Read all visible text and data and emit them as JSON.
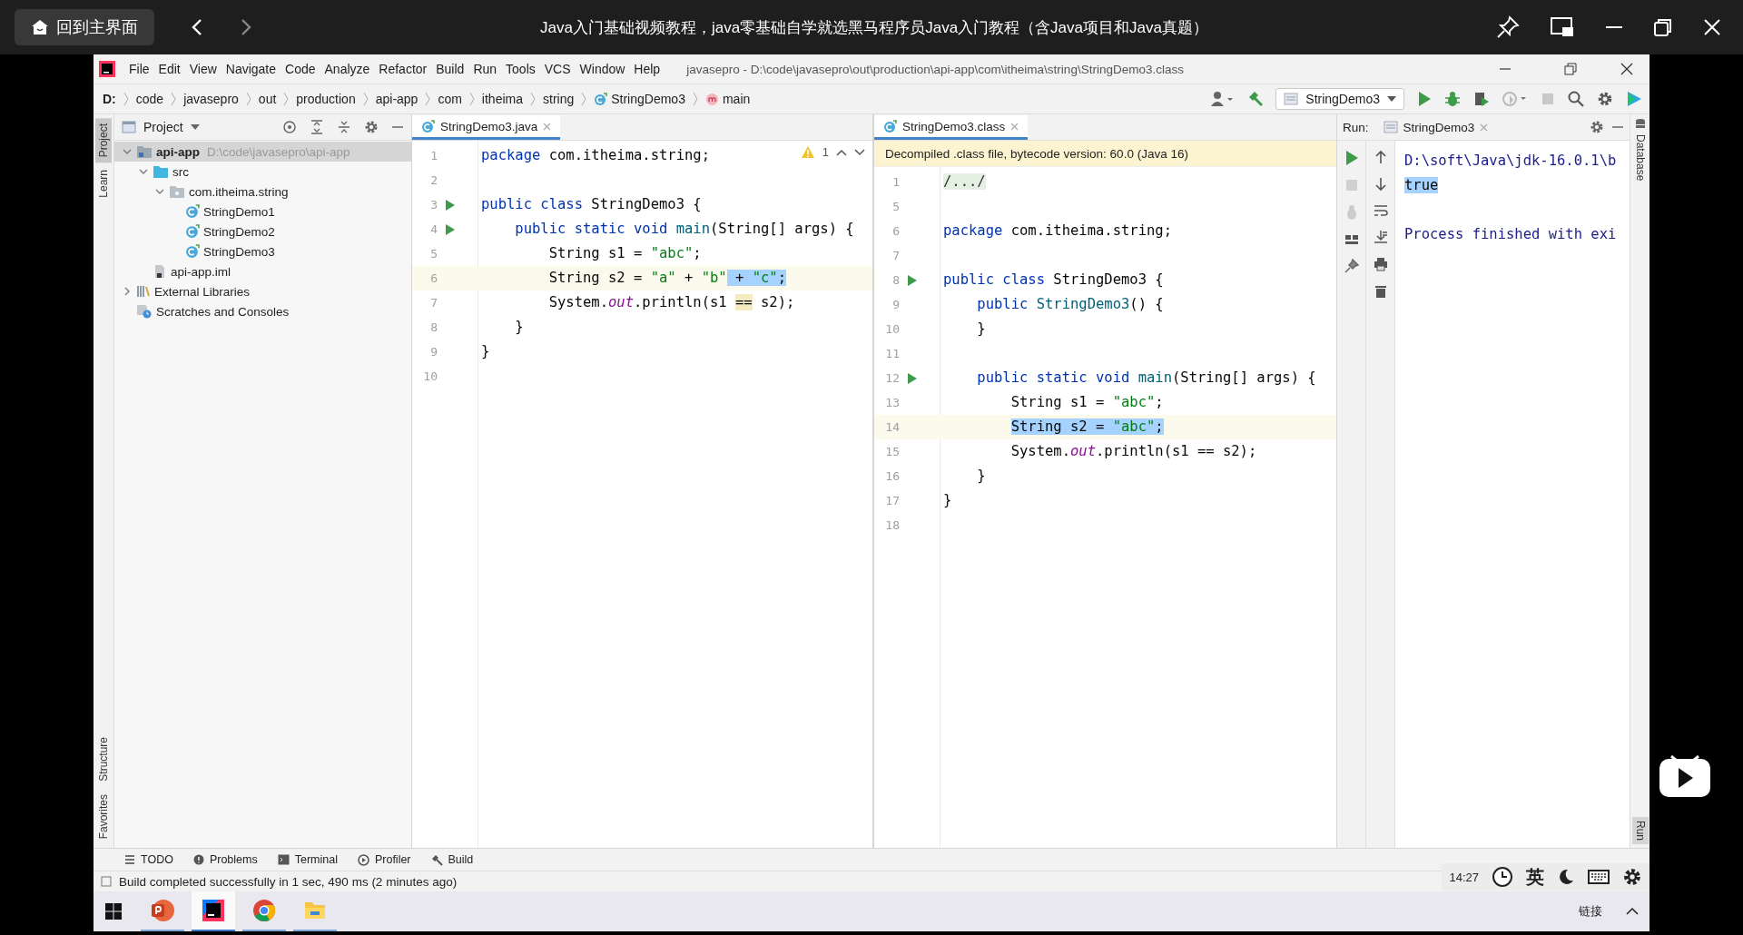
{
  "player": {
    "home_button": "回到主界面",
    "title": "Java入门基础视频教程，java零基础自学就选黑马程序员Java入门教程（含Java项目和Java真题）"
  },
  "ide": {
    "title_path": "javasepro - D:\\code\\javasepro\\out\\production\\api-app\\com\\itheima\\string\\StringDemo3.class",
    "menu": [
      "File",
      "Edit",
      "View",
      "Navigate",
      "Code",
      "Analyze",
      "Refactor",
      "Build",
      "Run",
      "Tools",
      "VCS",
      "Window",
      "Help"
    ],
    "breadcrumbs": [
      {
        "label": "D:",
        "kind": "drive"
      },
      {
        "label": "code",
        "kind": "folder"
      },
      {
        "label": "javasepro",
        "kind": "folder"
      },
      {
        "label": "out",
        "kind": "folder"
      },
      {
        "label": "production",
        "kind": "folder"
      },
      {
        "label": "api-app",
        "kind": "folder"
      },
      {
        "label": "com",
        "kind": "folder"
      },
      {
        "label": "itheima",
        "kind": "folder"
      },
      {
        "label": "string",
        "kind": "folder"
      },
      {
        "label": "StringDemo3",
        "kind": "class"
      },
      {
        "label": "main",
        "kind": "method"
      }
    ],
    "run_config": "StringDemo3",
    "left_strip_top": [
      {
        "label": "Project",
        "selected": true
      },
      {
        "label": "Learn",
        "selected": false
      }
    ],
    "left_strip_bottom": [
      {
        "label": "Structure",
        "selected": false
      },
      {
        "label": "Favorites",
        "selected": false
      }
    ],
    "project": {
      "title": "Project",
      "tree": [
        {
          "label": "api-app",
          "hint": "D:\\code\\javasepro\\api-app",
          "kind": "module",
          "expanded": true,
          "selected": true,
          "children": [
            {
              "label": "src",
              "kind": "folder",
              "expanded": true,
              "selected": false,
              "children": [
                {
                  "label": "com.itheima.string",
                  "kind": "package",
                  "expanded": true,
                  "selected": false,
                  "children": [
                    {
                      "label": "StringDemo1",
                      "kind": "class",
                      "selected": false
                    },
                    {
                      "label": "StringDemo2",
                      "kind": "class",
                      "selected": false
                    },
                    {
                      "label": "StringDemo3",
                      "kind": "class",
                      "selected": false
                    }
                  ]
                }
              ]
            },
            {
              "label": "api-app.iml",
              "kind": "iml",
              "selected": false
            }
          ]
        },
        {
          "label": "External Libraries",
          "kind": "libraries",
          "expanded": false,
          "selected": false
        },
        {
          "label": "Scratches and Consoles",
          "kind": "scratches",
          "selected": false
        }
      ]
    },
    "editors": [
      {
        "tab": "StringDemo3.java",
        "selected": true,
        "warning_count": "1",
        "lines": [
          {
            "num": "1",
            "run": false,
            "current": false,
            "segs": [
              {
                "kind": "keyword",
                "text": "package"
              },
              {
                "kind": "plain",
                "text": " com.itheima.string;"
              }
            ]
          },
          {
            "num": "2",
            "run": false,
            "current": false
          },
          {
            "num": "3",
            "run": true,
            "current": false,
            "segs": [
              {
                "kind": "keyword",
                "text": "public class"
              },
              {
                "kind": "plain",
                "text": " StringDemo3 {"
              }
            ]
          },
          {
            "num": "4",
            "run": true,
            "current": false,
            "segs": [
              {
                "kind": "keyword",
                "text": "    public static void"
              },
              {
                "kind": "method",
                "text": " main"
              },
              {
                "kind": "plain",
                "text": "(String[] args) {"
              }
            ]
          },
          {
            "num": "5",
            "run": false,
            "current": false,
            "segs": [
              {
                "kind": "plain",
                "text": "        String s1 = "
              },
              {
                "kind": "string",
                "text": "\"abc\""
              },
              {
                "kind": "plain",
                "text": ";"
              }
            ]
          },
          {
            "num": "6",
            "run": false,
            "current": true,
            "segs": [
              {
                "kind": "plain",
                "text": "        String s2 = "
              },
              {
                "kind": "string",
                "text": "\"a\""
              },
              {
                "kind": "plain",
                "text": " + "
              },
              {
                "kind": "string",
                "text": "\"b\""
              },
              {
                "kind": "selection",
                "text": " + "
              },
              {
                "kind": "selectedstring",
                "text": "\"c\""
              },
              {
                "kind": "selection",
                "text": ";"
              }
            ]
          },
          {
            "num": "7",
            "run": false,
            "current": false,
            "segs": [
              {
                "kind": "plain",
                "text": "        System."
              },
              {
                "kind": "field",
                "text": "out"
              },
              {
                "kind": "plain",
                "text": ".println(s1 "
              },
              {
                "kind": "usage",
                "text": "=="
              },
              {
                "kind": "plain",
                "text": " s2);"
              }
            ]
          },
          {
            "num": "8",
            "run": false,
            "current": false,
            "segs": [
              {
                "kind": "plain",
                "text": "    }"
              }
            ]
          },
          {
            "num": "9",
            "run": false,
            "current": false,
            "segs": [
              {
                "kind": "plain",
                "text": "}"
              }
            ]
          },
          {
            "num": "10",
            "run": false,
            "current": false
          }
        ]
      },
      {
        "tab": "StringDemo3.class",
        "selected": true,
        "banner": "Decompiled .class file, bytecode version: 60.0 (Java 16)",
        "lines": [
          {
            "num": "1",
            "run": false,
            "current": false,
            "segs": [
              {
                "kind": "fold",
                "text": "/.../"
              }
            ]
          },
          {
            "num": "5",
            "run": false,
            "current": false
          },
          {
            "num": "6",
            "run": false,
            "current": false,
            "segs": [
              {
                "kind": "keyword",
                "text": "package"
              },
              {
                "kind": "plain",
                "text": " com.itheima.string;"
              }
            ]
          },
          {
            "num": "7",
            "run": false,
            "current": false
          },
          {
            "num": "8",
            "run": true,
            "current": false,
            "segs": [
              {
                "kind": "keyword",
                "text": "public class"
              },
              {
                "kind": "plain",
                "text": " StringDemo3 {"
              }
            ]
          },
          {
            "num": "9",
            "run": false,
            "current": false,
            "segs": [
              {
                "kind": "keyword",
                "text": "    public"
              },
              {
                "kind": "method",
                "text": " StringDemo3"
              },
              {
                "kind": "plain",
                "text": "() {"
              }
            ]
          },
          {
            "num": "10",
            "run": false,
            "current": false,
            "segs": [
              {
                "kind": "plain",
                "text": "    }"
              }
            ]
          },
          {
            "num": "11",
            "run": false,
            "current": false
          },
          {
            "num": "12",
            "run": true,
            "current": false,
            "segs": [
              {
                "kind": "keyword",
                "text": "    public static void"
              },
              {
                "kind": "method",
                "text": " main"
              },
              {
                "kind": "plain",
                "text": "(String[] args) {"
              }
            ]
          },
          {
            "num": "13",
            "run": false,
            "current": false,
            "segs": [
              {
                "kind": "plain",
                "text": "        String s1 = "
              },
              {
                "kind": "string",
                "text": "\"abc\""
              },
              {
                "kind": "plain",
                "text": ";"
              }
            ]
          },
          {
            "num": "14",
            "run": false,
            "current": true,
            "segs": [
              {
                "kind": "selection",
                "text": "        String s2 = "
              },
              {
                "kind": "selectedstring",
                "text": "\"abc\""
              },
              {
                "kind": "selection",
                "text": ";"
              }
            ]
          },
          {
            "num": "15",
            "run": false,
            "current": false,
            "segs": [
              {
                "kind": "plain",
                "text": "        System."
              },
              {
                "kind": "field",
                "text": "out"
              },
              {
                "kind": "plain",
                "text": ".println(s1 == s2);"
              }
            ]
          },
          {
            "num": "16",
            "run": false,
            "current": false,
            "segs": [
              {
                "kind": "plain",
                "text": "    }"
              }
            ]
          },
          {
            "num": "17",
            "run": false,
            "current": false,
            "segs": [
              {
                "kind": "plain",
                "text": "}"
              }
            ]
          },
          {
            "num": "18",
            "run": false,
            "current": false
          }
        ]
      }
    ],
    "run": {
      "label": "Run:",
      "tab": "StringDemo3",
      "output": [
        {
          "text": "D:\\soft\\Java\\jdk-16.0.1\\b",
          "kind": "system",
          "selected": false
        },
        {
          "text": "true",
          "kind": "stdout",
          "selected": true
        },
        {
          "kind": "blank"
        },
        {
          "text": "Process finished with exi",
          "kind": "system",
          "selected": false
        }
      ]
    },
    "right_strip_top": "Database",
    "right_strip_bottom": "Run",
    "bottom_tabs": [
      {
        "label": "TODO",
        "kind": "todo"
      },
      {
        "label": "Problems",
        "kind": "problems"
      },
      {
        "label": "Terminal",
        "kind": "terminal"
      },
      {
        "label": "Profiler",
        "kind": "profiler"
      },
      {
        "label": "Build",
        "kind": "build"
      }
    ],
    "status": "Build completed successfully in 1 sec, 490 ms (2 minutes ago)"
  },
  "overlay": {
    "time": "14:27",
    "ime": "英"
  },
  "taskbar": {
    "apps": [
      {
        "kind": "powerpoint",
        "selected": false
      },
      {
        "kind": "intellij",
        "selected": true
      },
      {
        "kind": "chrome",
        "selected": false
      },
      {
        "kind": "explorer",
        "selected": false
      }
    ],
    "tray_label": "链接"
  }
}
